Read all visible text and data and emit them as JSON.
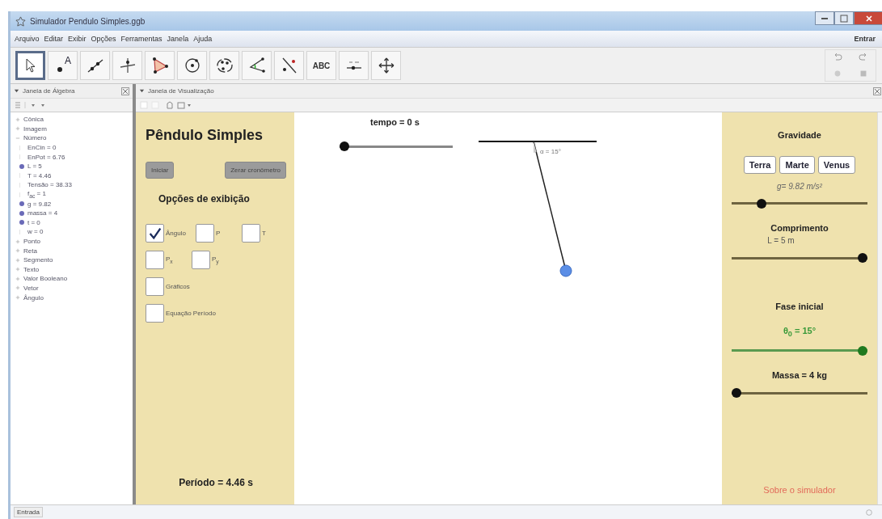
{
  "window": {
    "title": "Simulador Pendulo Simples.ggb"
  },
  "menu": [
    "Arquivo",
    "Editar",
    "Exibir",
    "Opções",
    "Ferramentas",
    "Janela",
    "Ajuda"
  ],
  "sign_in": "Entrar",
  "tools": [
    {
      "kind": "move",
      "selected": true
    },
    {
      "kind": "point",
      "label": "A",
      "selected": false
    },
    {
      "kind": "line",
      "selected": false
    },
    {
      "kind": "perpendicular",
      "selected": false
    },
    {
      "kind": "polygon",
      "selected": false
    },
    {
      "kind": "circle",
      "selected": false
    },
    {
      "kind": "conic",
      "selected": false
    },
    {
      "kind": "angle",
      "selected": false
    },
    {
      "kind": "reflect",
      "selected": false
    },
    {
      "kind": "text",
      "label": "ABC",
      "selected": false
    },
    {
      "kind": "slider",
      "selected": false
    },
    {
      "kind": "pan",
      "selected": false
    }
  ],
  "algebra": {
    "title": "Janela de Álgebra",
    "items": [
      {
        "label": "Cônica",
        "expanded": false
      },
      {
        "label": "Imagem",
        "expanded": false
      },
      {
        "label": "Número",
        "expanded": true,
        "children": [
          {
            "label": "EnCin = 0",
            "shown": false
          },
          {
            "label": "EnPot = 6.76",
            "shown": false
          },
          {
            "label": "L = 5",
            "shown": true
          },
          {
            "label": "T = 4.46",
            "shown": false
          },
          {
            "label": "Tensão = 38.33",
            "shown": false
          },
          {
            "label": "f$_{ac}$ = 1",
            "shown": false
          },
          {
            "label": "g = 9.82",
            "shown": true
          },
          {
            "label": "massa = 4",
            "shown": true
          },
          {
            "label": "t = 0",
            "shown": true
          },
          {
            "label": "w = 0",
            "shown": false
          }
        ]
      },
      {
        "label": "Ponto",
        "expanded": false
      },
      {
        "label": "Reta",
        "expanded": false
      },
      {
        "label": "Segmento",
        "expanded": false
      },
      {
        "label": "Texto",
        "expanded": false
      },
      {
        "label": "Valor Booleano",
        "expanded": false
      },
      {
        "label": "Vetor",
        "expanded": false
      },
      {
        "label": "Ângulo",
        "expanded": false
      }
    ]
  },
  "graphics": {
    "title": "Janela de Visualização",
    "left_panel": {
      "title": "Pêndulo Simples",
      "buttons": [
        "Iniciar",
        "Zerar cronômetro"
      ],
      "options_title": "Opções de exibição",
      "checkbox_rows": [
        [
          {
            "label": "Ângulo",
            "checked": true
          },
          {
            "label": "P",
            "checked": false
          },
          {
            "label": "T",
            "checked": false
          }
        ],
        [
          {
            "label": "P$_{x}$",
            "checked": false
          },
          {
            "label": "P$_{y}$",
            "checked": false
          }
        ],
        [
          {
            "label": "Gráficos",
            "checked": false
          }
        ],
        [
          {
            "label": "Equação Período",
            "checked": false
          }
        ]
      ],
      "period": "Período = 4.46 s"
    },
    "canvas": {
      "time_label": "tempo = 0 s",
      "time_slider": {
        "level": 0
      },
      "angle_label": "α = 15°"
    },
    "right_panel": {
      "gravity_title": "Gravidade",
      "planets": [
        "Terra",
        "Marte",
        "Venus"
      ],
      "gravity_value": "g= 9.82 m/s²",
      "gravity_slider": {
        "level": 0.2
      },
      "length_title": "Comprimento",
      "length_value": "L = 5 m",
      "length_slider": {
        "level": 1
      },
      "phase_title": "Fase inicial",
      "phase_value": "θ$_{0}$ = 15°",
      "phase_slider": {
        "level": 1
      },
      "mass_title": "Massa = 4 kg",
      "mass_slider": {
        "level": 0
      },
      "about_link": "Sobre o simulador"
    }
  },
  "input_bar": {
    "label": "Entrada"
  }
}
